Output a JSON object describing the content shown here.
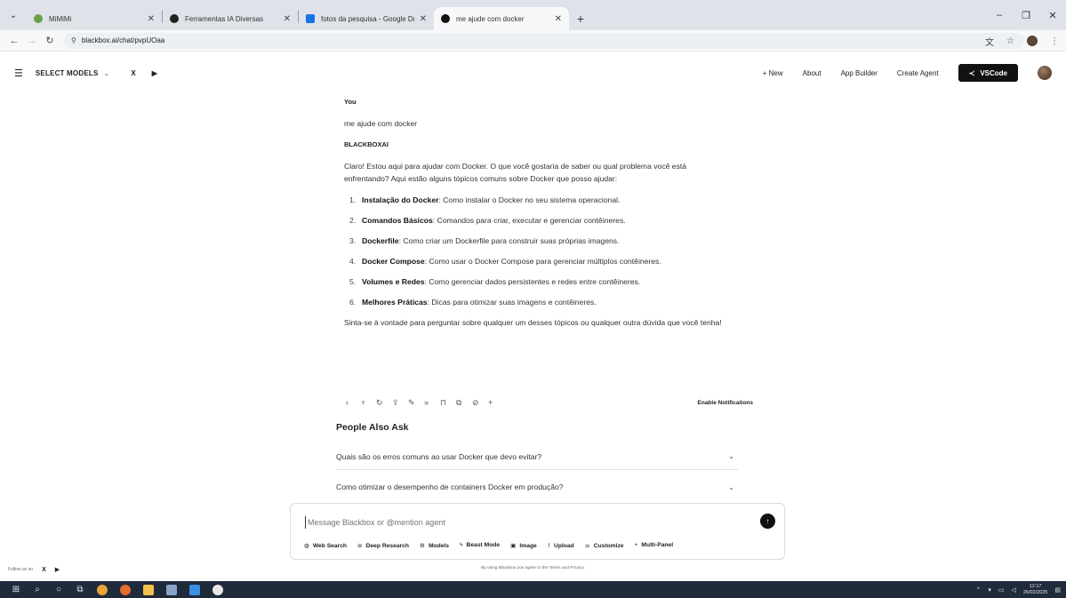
{
  "browser": {
    "tabs": [
      {
        "title": "MiMiMi",
        "favicon_color": "#6aa04b",
        "active": false
      },
      {
        "title": "Ferramentas IA Diversas",
        "favicon_color": "#222222",
        "active": false
      },
      {
        "title": "fotos da pesquisa - Google Dri",
        "favicon_color": "#1a73e8",
        "active": false
      },
      {
        "title": "me ajude com docker",
        "favicon_color": "#111111",
        "active": true
      }
    ],
    "new_tab": "+",
    "url": "blackbox.ai/chat/pvpUOaa"
  },
  "header": {
    "select_models": "SELECT MODELS",
    "x_label": "X",
    "youtube_label": "▶",
    "new": "+ New",
    "about": "About",
    "app_builder": "App Builder",
    "create_agent": "Create Agent",
    "vscode": "VSCode"
  },
  "chat": {
    "user_role": "You",
    "user_message": "me ajude com docker",
    "ai_role": "BLACKBOXAI",
    "intro": "Claro! Estou aqui para ajudar com Docker. O que você gostaria de saber ou qual problema você está enfrentando? Aqui estão alguns tópicos comuns sobre Docker que posso ajudar:",
    "items": [
      {
        "num": "1.",
        "title": "Instalação do Docker",
        "text": ": Como instalar o Docker no seu sistema operacional."
      },
      {
        "num": "2.",
        "title": "Comandos Básicos",
        "text": ": Comandos para criar, executar e gerenciar contêineres."
      },
      {
        "num": "3.",
        "title": "Dockerfile",
        "text": ": Como criar um Dockerfile para construir suas próprias imagens."
      },
      {
        "num": "4.",
        "title": "Docker Compose",
        "text": ": Como usar o Docker Compose para gerenciar múltiplos contêineres."
      },
      {
        "num": "5.",
        "title": "Volumes e Redes",
        "text": ": Como gerenciar dados persistentes e redes entre contêineres."
      },
      {
        "num": "6.",
        "title": "Melhores Práticas",
        "text": ": Dicas para otimizar suas imagens e contêineres."
      }
    ],
    "closing": "Sinta-se à vontade para perguntar sobre qualquer um desses tópicos ou qualquer outra dúvida que você tenha!",
    "enable_notifications": "Enable Notifications"
  },
  "people_also_ask": {
    "title": "People Also Ask",
    "q1": "Quais são os erros comuns ao usar Docker que devo evitar?",
    "q2": "Como otimizar o desempenho de containers Docker em produção?"
  },
  "composer": {
    "placeholder": "Message Blackbox or @mention agent",
    "tools": {
      "web_search": "Web Search",
      "deep_research": "Deep Research",
      "models": "Models",
      "beast_mode": "Beast Mode",
      "image": "Image",
      "upload": "Upload",
      "customize": "Customize",
      "multi_panel": "Multi-Panel"
    }
  },
  "footer": {
    "terms": "By using Blackbox you agree to the Terms and Privacy.",
    "follow": "Follow us on"
  },
  "taskbar": {
    "time": "12:17",
    "date": "26/02/2025"
  }
}
